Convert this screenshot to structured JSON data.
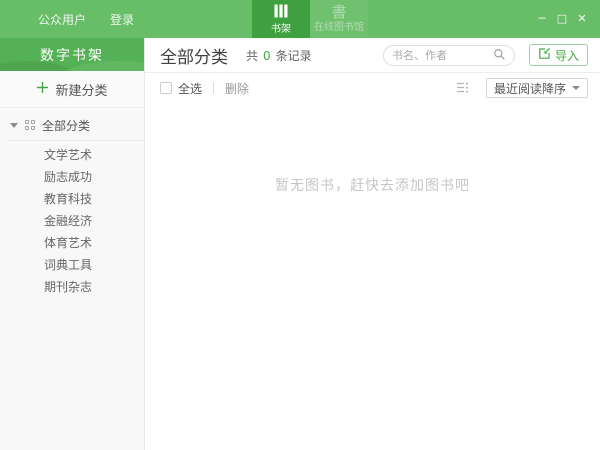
{
  "topbar": {
    "user_label": "公众用户",
    "login_label": "登录",
    "tabs": [
      {
        "label": "书架",
        "icon": "bookshelf-icon",
        "active": true
      },
      {
        "label": "在线图书馆",
        "icon": "online-library-icon",
        "icon_glyph": "書",
        "active": false
      }
    ],
    "window_controls": {
      "minimize": "─",
      "maximize": "□",
      "close": "✕"
    }
  },
  "sidebar": {
    "title": "数字书架",
    "new_category_label": "新建分类",
    "tree_root": "全部分类",
    "categories": [
      "文学艺术",
      "励志成功",
      "教育科技",
      "金融经济",
      "体育艺术",
      "词典工具",
      "期刊杂志"
    ]
  },
  "main": {
    "title": "全部分类",
    "count_prefix": "共",
    "count_value": "0",
    "count_suffix": "条记录",
    "search_placeholder": "书名、作者",
    "import_label": "导入",
    "select_all_label": "全选",
    "delete_label": "删除",
    "sort_label": "最近阅读降序",
    "empty_message": "暂无图书，赶快去添加图书吧"
  },
  "colors": {
    "topbar_green": "#68bd68",
    "active_tab_green": "#3fa03f",
    "sidebar_header_green": "#55b155",
    "accent_green": "#47a747",
    "sidebar_bg": "#f8f8f8",
    "empty_text": "#c6c6c6"
  }
}
